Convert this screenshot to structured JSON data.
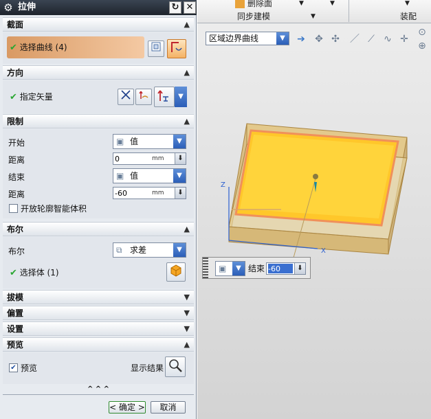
{
  "dialog": {
    "title": "拉伸",
    "reset_glyph": "↻",
    "close_glyph": "✕"
  },
  "sections": {
    "section": {
      "title": "截面",
      "select_curve": "选择曲线 (4)"
    },
    "direction": {
      "title": "方向",
      "specify_vector": "指定矢量"
    },
    "limits": {
      "title": "限制",
      "start_label": "开始",
      "start_value": "值",
      "start_distance_label": "距离",
      "start_distance": "0",
      "end_label": "结束",
      "end_value": "值",
      "end_distance_label": "距离",
      "end_distance": "-60",
      "unit": "mm",
      "open_profile": "开放轮廓智能体积"
    },
    "boolean": {
      "title": "布尔",
      "boolean_label": "布尔",
      "boolean_value": "求差",
      "select_body": "选择体 (1)"
    },
    "draft": {
      "title": "拔模"
    },
    "offset": {
      "title": "偏置"
    },
    "settings": {
      "title": "设置"
    },
    "preview": {
      "title": "预览",
      "preview_label": "预览",
      "show_result": "显示结果"
    }
  },
  "footer": {
    "ok": "< 确定 >",
    "cancel": "取消",
    "more": "^ ^ ^"
  },
  "ribbon": {
    "delete_face": "删除面",
    "sync_modeling": "同步建模",
    "assembly": "装配"
  },
  "viewport_toolbar": {
    "selection_filter": "区域边界曲线"
  },
  "onscreen_input": {
    "end_label": "结束",
    "end_value": "-60"
  },
  "colors": {
    "accent_orange": "#f2b46e",
    "solid_yellow": "#ffc72a",
    "check_green": "#2aa632"
  }
}
